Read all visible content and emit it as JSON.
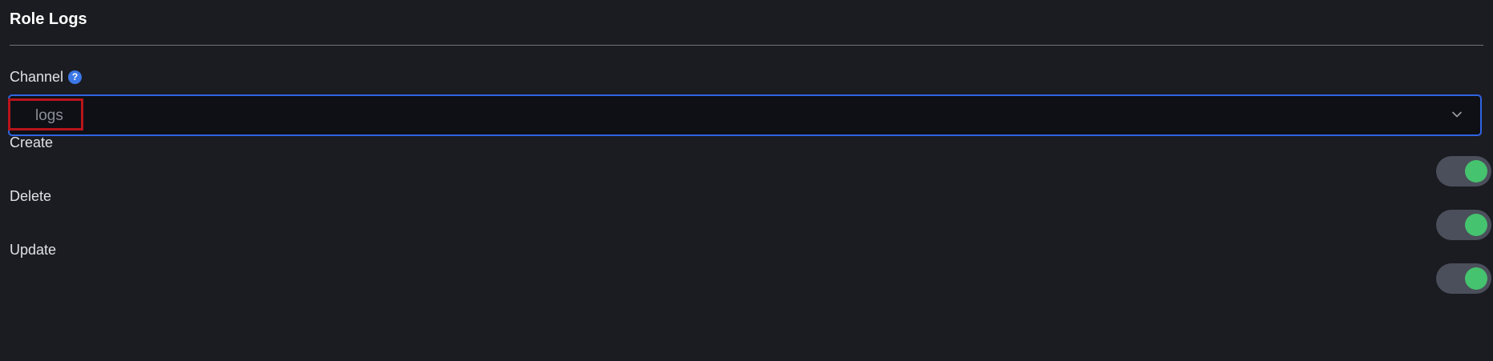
{
  "section": {
    "title": "Role Logs"
  },
  "channel": {
    "label": "Channel",
    "help_icon": "question-circle-icon",
    "selected_value": "logs",
    "dropdown_icon": "chevron-down-icon"
  },
  "toggles": [
    {
      "label": "Create",
      "enabled": true
    },
    {
      "label": "Delete",
      "enabled": true
    },
    {
      "label": "Update",
      "enabled": true
    }
  ],
  "colors": {
    "background": "#1b1c21",
    "select_border": "#2f65e3",
    "highlight_frame": "#b9141c",
    "toggle_track": "#4b4f5b",
    "toggle_knob_on": "#45c36e",
    "help_icon": "#3b77e6"
  }
}
